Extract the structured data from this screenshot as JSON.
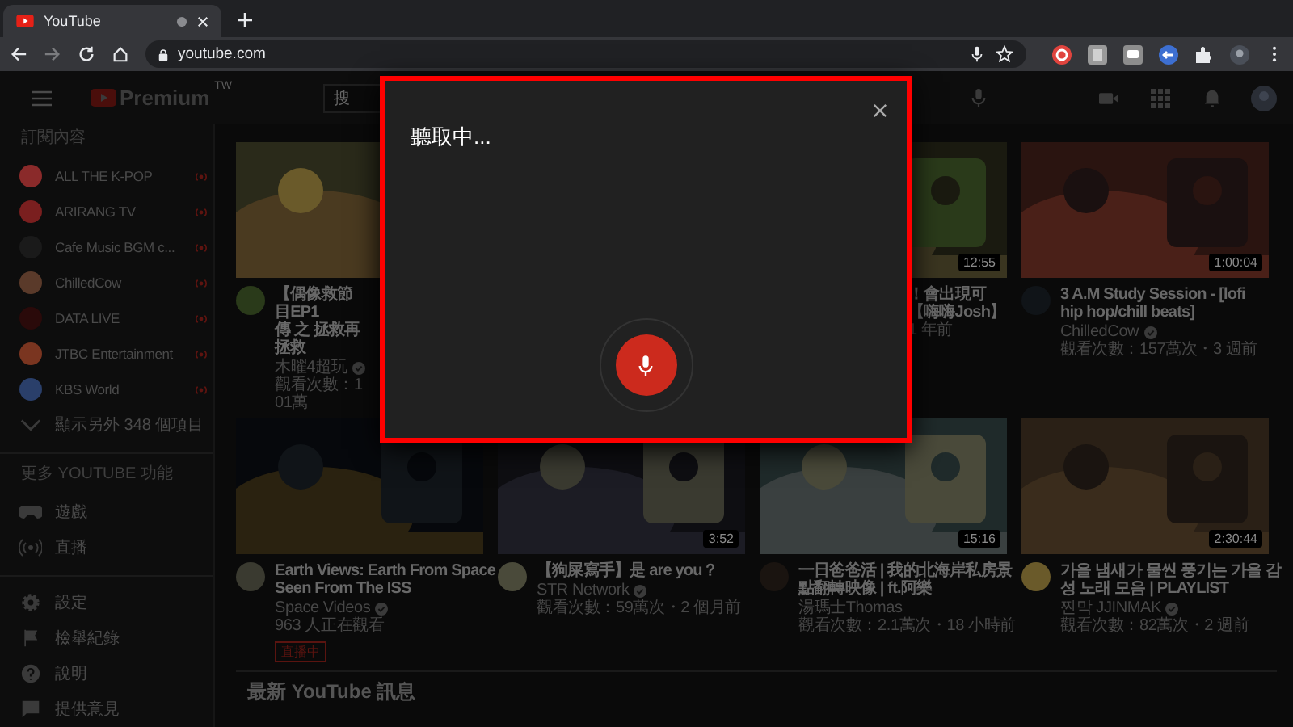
{
  "browser": {
    "tab": {
      "title": "YouTube",
      "selected": true
    },
    "address": "youtube.com"
  },
  "header": {
    "logo_text": "Premium",
    "region": "TW",
    "search": {
      "placeholder": "搜"
    }
  },
  "sidebar": {
    "subscriptions_title": "訂閱內容",
    "channels": [
      {
        "name": "ALL THE K-POP",
        "color": "#8a2a2a",
        "live": true
      },
      {
        "name": "ARIRANG TV",
        "color": "#7a1f1f",
        "live": true
      },
      {
        "name": "Cafe Music BGM c...",
        "color": "#1a1a1a",
        "live": true
      },
      {
        "name": "ChilledCow",
        "color": "#5a3a2a",
        "live": true
      },
      {
        "name": "DATA LIVE",
        "color": "#2a0a0a",
        "live": true
      },
      {
        "name": "JTBC Entertainment",
        "color": "#7a3520",
        "live": true
      },
      {
        "name": "KBS World",
        "color": "#2a3f6a",
        "live": true
      }
    ],
    "show_more": "顯示另外 348 個項目",
    "more_title": "更多 YOUTUBE 功能",
    "features": [
      {
        "label": "遊戲",
        "kind": "gaming"
      },
      {
        "label": "直播",
        "kind": "live"
      }
    ],
    "footer": [
      {
        "label": "設定",
        "kind": "settings"
      },
      {
        "label": "檢舉紀錄",
        "kind": "flag"
      },
      {
        "label": "說明",
        "kind": "help"
      },
      {
        "label": "提供意見",
        "kind": "feedback"
      }
    ]
  },
  "rows": [
    {
      "cards": [
        {
          "title_lines": [
            "【偶像救節目EP1",
            "傳 之 拯救再拯救"
          ],
          "channel": "木曜4超玩",
          "verified": true,
          "views": "觀看次數：101萬"
        },
        {
          "title_lines": [
            "！會出現可",
            "【嗨嗨Josh】"
          ],
          "views": "1 年前",
          "duration": "12:55"
        },
        {
          "title_lines": [
            "3 A.M Study Session - [lofi",
            "hip hop/chill beats]"
          ],
          "channel": "ChilledCow",
          "verified": true,
          "views": "觀看次數：157萬次・3 週前",
          "duration": "1:00:04"
        }
      ]
    },
    {
      "cards": [
        {
          "title_lines": [
            "Earth Views: Earth From Space",
            "Seen From The ISS"
          ],
          "channel": "Space Videos",
          "verified": true,
          "views": "963 人正在觀看",
          "badge": "直播中"
        },
        {
          "title_lines": [
            "【狗屎寫手】是 are you？"
          ],
          "channel": "STR Network",
          "verified": true,
          "views": "觀看次數：59萬次・2 個月前",
          "duration": "3:52"
        },
        {
          "title_lines": [
            "一日爸爸活 | 我的北海岸私房景",
            "點翻轉映像 | ft.阿樂"
          ],
          "channel": "湯瑪士Thomas",
          "verified": false,
          "views": "觀看次數：2.1萬次・18 小時前",
          "duration": "15:16"
        },
        {
          "title_lines": [
            "가을 냄새가 물씬 풍기는 가을 감",
            "성 노래 모음 | PLAYLIST"
          ],
          "channel": "찐막 JJINMAK",
          "verified": true,
          "views": "觀看次數：82萬次・2 週前",
          "duration": "2:30:44"
        }
      ]
    }
  ],
  "section_title": "最新 YouTube 訊息",
  "dialog": {
    "title": "聽取中...",
    "listening": true
  }
}
